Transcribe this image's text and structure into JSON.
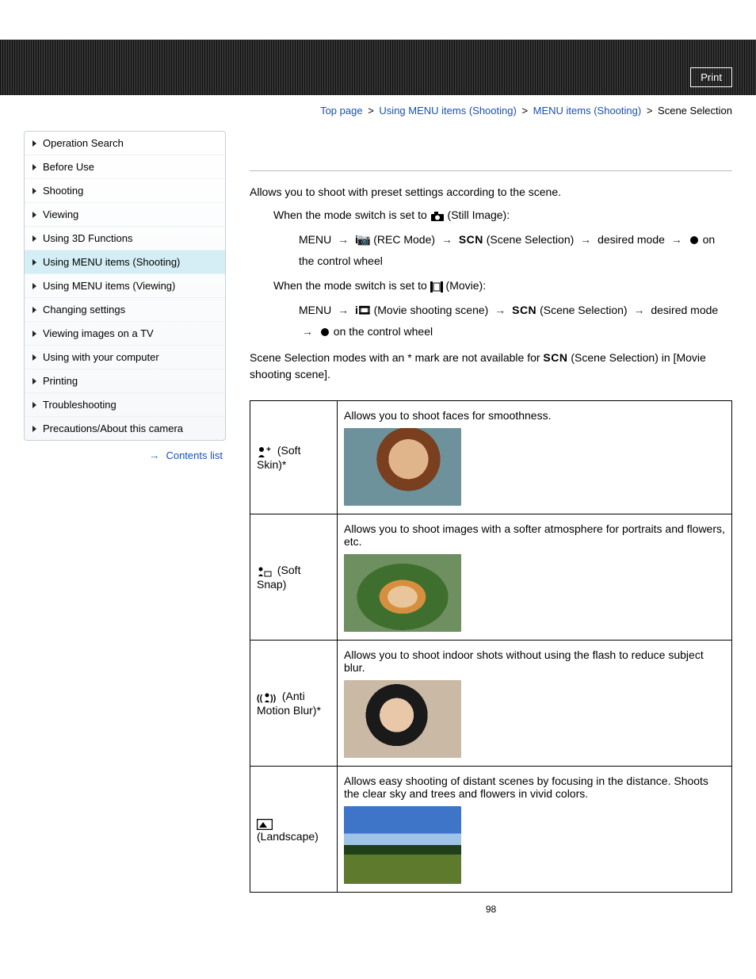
{
  "header": {
    "print": "Print"
  },
  "breadcrumb": {
    "top": "Top page",
    "cat1": "Using MENU items (Shooting)",
    "cat2": "MENU items (Shooting)",
    "current": "Scene Selection"
  },
  "sidebar": {
    "items": [
      {
        "label": "Operation Search",
        "active": false
      },
      {
        "label": "Before Use",
        "active": false
      },
      {
        "label": "Shooting",
        "active": false
      },
      {
        "label": "Viewing",
        "active": false
      },
      {
        "label": "Using 3D Functions",
        "active": false
      },
      {
        "label": "Using MENU items (Shooting)",
        "active": true
      },
      {
        "label": "Using MENU items (Viewing)",
        "active": false
      },
      {
        "label": "Changing settings",
        "active": false
      },
      {
        "label": "Viewing images on a TV",
        "active": false
      },
      {
        "label": "Using with your computer",
        "active": false
      },
      {
        "label": "Printing",
        "active": false
      },
      {
        "label": "Troubleshooting",
        "active": false
      },
      {
        "label": "Precautions/About this camera",
        "active": false
      }
    ],
    "contents_list": "Contents list"
  },
  "content": {
    "intro": "Allows you to shoot with preset settings according to the scene.",
    "step1_prefix": "When the mode switch is set to ",
    "still_label": "(Still Image):",
    "menu_txt": "MENU",
    "rec_mode": "(REC Mode)",
    "scene_sel": "(Scene Selection)",
    "desired": "desired mode",
    "wheel": "on the control wheel",
    "step2_prefix": "When the mode switch is set to ",
    "movie_label": "(Movie):",
    "movie_scene": "(Movie shooting scene)",
    "note": "Scene Selection modes with an * mark are not available for ",
    "note_tail": "(Scene Selection) in [Movie shooting scene].",
    "modes": [
      {
        "name": "(Soft Skin)*",
        "desc": "Allows you to shoot faces for smoothness."
      },
      {
        "name": "(Soft Snap)",
        "desc": "Allows you to shoot images with a softer atmosphere for portraits and flowers, etc."
      },
      {
        "name": "(Anti Motion Blur)*",
        "desc": "Allows you to shoot indoor shots without using the flash to reduce subject blur."
      },
      {
        "name": "(Landscape)",
        "desc": "Allows easy shooting of distant scenes by focusing in the distance. Shoots the clear sky and trees and flowers in vivid colors."
      }
    ]
  },
  "page_number": "98"
}
